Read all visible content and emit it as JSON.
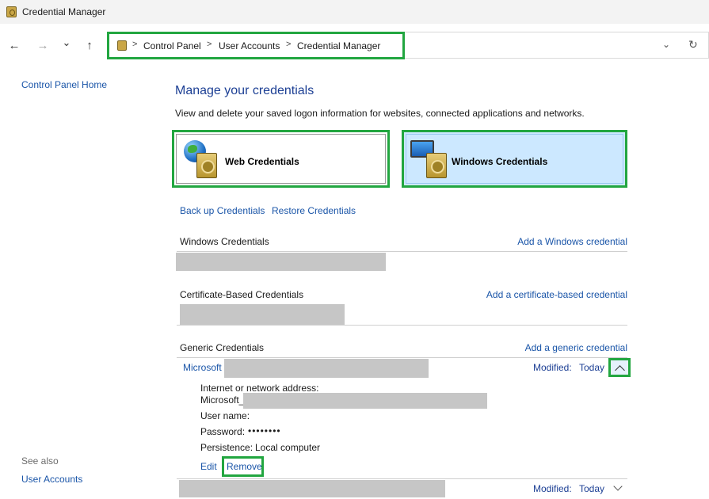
{
  "window": {
    "title": "Credential Manager"
  },
  "nav": {
    "back_icon": "←",
    "forward_icon": "→",
    "recent_icon": "⌄",
    "up_icon": "↑",
    "breadcrumbs": [
      "Control Panel",
      "User Accounts",
      "Credential Manager"
    ],
    "separator": ">",
    "dropdown_icon": "⌄",
    "refresh_icon": "↻"
  },
  "sidebar": {
    "home_link": "Control Panel Home",
    "see_also_label": "See also",
    "see_also_links": [
      "User Accounts"
    ]
  },
  "main": {
    "title": "Manage your credentials",
    "description": "View and delete your saved logon information for websites, connected applications and networks.",
    "tiles": [
      {
        "label": "Web Credentials",
        "icon": "globe-safe-icon",
        "selected": false
      },
      {
        "label": "Windows Credentials",
        "icon": "monitor-safe-icon",
        "selected": true
      }
    ],
    "backup_link": "Back up Credentials",
    "restore_link": "Restore Credentials",
    "sections": {
      "windows": {
        "heading": "Windows Credentials",
        "add_link": "Add a Windows credential"
      },
      "certificate": {
        "heading": "Certificate-Based Credentials",
        "add_link": "Add a certificate-based credential"
      },
      "generic": {
        "heading": "Generic Credentials",
        "add_link": "Add a generic credential",
        "entries": [
          {
            "name": "Microsoft",
            "modified_label": "Modified:",
            "modified_value": "Today",
            "expanded": true,
            "details": {
              "address_label": "Internet or network address:",
              "address_value": "Microsoft_",
              "username_label": "User name:",
              "password_label": "Password:",
              "password_value": "••••••••",
              "persistence_label": "Persistence:",
              "persistence_value": "Local computer"
            },
            "edit_link": "Edit",
            "remove_link": "Remove"
          },
          {
            "name": "",
            "modified_label": "Modified:",
            "modified_value": "Today",
            "expanded": false
          }
        ]
      }
    }
  },
  "colors": {
    "highlight": "#22a640",
    "link": "#1a55a8",
    "heading": "#1c3f94",
    "selected_tile": "#cce8ff",
    "redaction": "#c6c6c6"
  }
}
